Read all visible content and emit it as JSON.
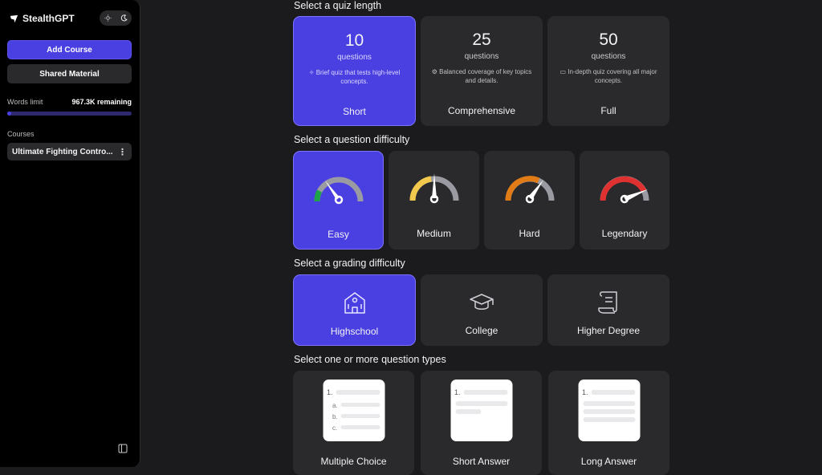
{
  "sidebar": {
    "brand": "StealthGPT",
    "add_course": "Add Course",
    "shared_material": "Shared Material",
    "words_label": "Words limit",
    "words_remaining": "967.3K remaining",
    "words_used_fraction": 0.03,
    "courses_label": "Courses",
    "course_name": "Ultimate Fighting Contro...",
    "icons": [
      "sun-icon",
      "moon-icon",
      "more-vertical-icon",
      "sidebar-collapse-icon"
    ]
  },
  "quiz_length": {
    "title": "Select a quiz length",
    "options": [
      {
        "number": "10",
        "unit": "questions",
        "desc": "Brief quiz that tests high-level concepts.",
        "label": "Short",
        "selected": true
      },
      {
        "number": "25",
        "unit": "questions",
        "desc": "Balanced coverage of key topics and details.",
        "label": "Comprehensive",
        "selected": false
      },
      {
        "number": "50",
        "unit": "questions",
        "desc": "In-depth quiz covering all major concepts.",
        "label": "Full",
        "selected": false
      }
    ]
  },
  "question_difficulty": {
    "title": "Select a question difficulty",
    "options": [
      {
        "label": "Easy",
        "selected": true,
        "color": "#1fa34a"
      },
      {
        "label": "Medium",
        "selected": false,
        "color": "#f2c94c"
      },
      {
        "label": "Hard",
        "selected": false,
        "color": "#e07b16"
      },
      {
        "label": "Legendary",
        "selected": false,
        "color": "#e03131"
      }
    ]
  },
  "grading_difficulty": {
    "title": "Select a grading difficulty",
    "options": [
      {
        "label": "Highschool",
        "selected": true,
        "icon": "school-building-icon"
      },
      {
        "label": "College",
        "selected": false,
        "icon": "graduation-cap-icon"
      },
      {
        "label": "Higher Degree",
        "selected": false,
        "icon": "scroll-icon"
      }
    ]
  },
  "question_types": {
    "title": "Select one or more question types",
    "options": [
      {
        "label": "Multiple Choice",
        "number": "1.",
        "choices": [
          "a.",
          "b.",
          "c."
        ]
      },
      {
        "label": "Short Answer",
        "number": "1."
      },
      {
        "label": "Long Answer",
        "number": "1."
      }
    ]
  },
  "colors": {
    "accent": "#4a3fe0",
    "card": "#2a2a2c",
    "background": "#1b1b1d",
    "sidebar": "#000000"
  }
}
